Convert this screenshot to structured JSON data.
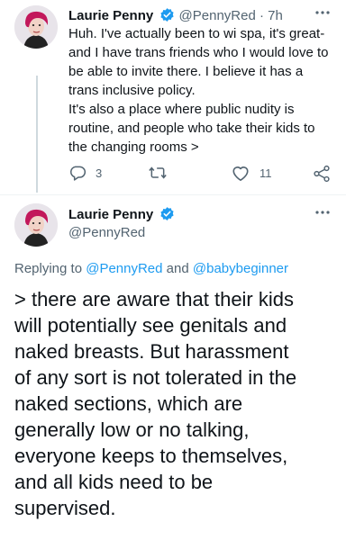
{
  "first_tweet": {
    "author_name": "Laurie Penny",
    "handle": "@PennyRed",
    "separator": " · ",
    "time": "7h",
    "text_lines": [
      "Huh. I've actually been to wi spa, it's great-",
      "and I have trans friends who I would love to",
      "be able to invite there. I believe it has a",
      "trans inclusive policy.",
      "It's also a place where public nudity is",
      "routine, and people who take their kids to",
      "the changing rooms >"
    ],
    "actions": {
      "reply_count": "3",
      "retweet_count": "",
      "like_count": "11"
    }
  },
  "second_tweet": {
    "author_name": "Laurie Penny",
    "handle": "@PennyRed",
    "replying_prefix": "Replying to ",
    "replying_user1": "@PennyRed",
    "replying_and": " and ",
    "replying_user2": "@babybeginner",
    "text_lines": [
      "> there are aware that their kids",
      "will potentially see genitals and",
      "naked breasts. But harassment",
      "of any sort is not tolerated in the",
      "naked sections, which are",
      "generally low or no talking,",
      "everyone keeps to themselves,",
      "and all kids need to be",
      "supervised."
    ]
  },
  "icons": {
    "more": "more-horizontal-icon",
    "verified": "verified-badge-icon",
    "reply": "reply-icon",
    "retweet": "retweet-icon",
    "like": "heart-icon",
    "share": "share-icon"
  },
  "colors": {
    "accent": "#1d9bf0",
    "secondary_text": "#536471",
    "avatar_hair": "#c2185b"
  }
}
